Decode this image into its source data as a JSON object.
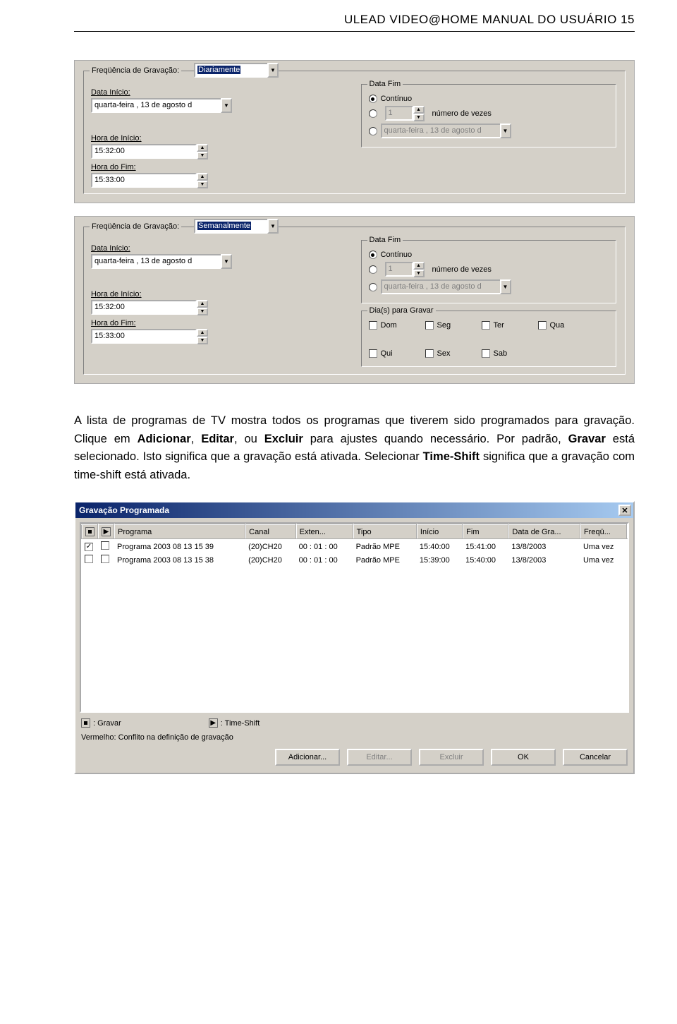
{
  "header": "ULEAD VIDEO@HOME MANUAL DO USUÁRIO  15",
  "panel1": {
    "freq_label": "Freqüência de Gravação:",
    "freq_value": "Diariamente",
    "start_date_label": "Data Início:",
    "start_date_value": "quarta-feira , 13 de   agosto   d",
    "end_group_label": "Data Fim",
    "radio_continuous": "Contínuo",
    "radio_times_value": "1",
    "radio_times_label": "número de vezes",
    "radio_date_value": "quarta-feira , 13 de   agosto   d",
    "start_time_label": "Hora de Início:",
    "start_time_value": "15:32:00",
    "end_time_label": "Hora do Fim:",
    "end_time_value": "15:33:00"
  },
  "panel2": {
    "freq_label": "Freqüência de Gravação:",
    "freq_value": "Semanalmente",
    "start_date_label": "Data Início:",
    "start_date_value": "quarta-feira , 13 de   agosto   d",
    "end_group_label": "Data Fim",
    "radio_continuous": "Contínuo",
    "radio_times_value": "1",
    "radio_times_label": "número de vezes",
    "radio_date_value": "quarta-feira , 13 de   agosto   d",
    "start_time_label": "Hora de Início:",
    "start_time_value": "15:32:00",
    "end_time_label": "Hora do Fim:",
    "end_time_value": "15:33:00",
    "days_label": "Dia(s) para Gravar",
    "days": [
      "Dom",
      "Seg",
      "Ter",
      "Qua",
      "Qui",
      "Sex",
      "Sab"
    ]
  },
  "paragraph": {
    "t1": "A lista de programas de TV mostra todos os programas que tiverem sido programados para gravação. Clique em ",
    "b1": "Adicionar",
    "t2": ", ",
    "b2": "Editar",
    "t3": ", ou ",
    "b3": "Excluir",
    "t4": " para ajustes quando necessário. Por padrão, ",
    "b4": "Gravar",
    "t5": " está selecionado. Isto significa que a gravação está ativada. Selecionar ",
    "b5": "Time-Shift",
    "t6": " significa que a gravação com time-shift está ativada."
  },
  "window": {
    "title": "Gravação Programada",
    "headers": [
      "",
      "",
      "Programa",
      "Canal",
      "Exten...",
      "Tipo",
      "Início",
      "Fim",
      "Data de Gra...",
      "Freqü..."
    ],
    "rows": [
      {
        "chk1": true,
        "chk2": false,
        "programa": "Programa 2003 08 13 15 39",
        "canal": "(20)CH20",
        "exten": "00 : 01 : 00",
        "tipo": "Padrão MPE",
        "inicio": "15:40:00",
        "fim": "15:41:00",
        "data": "13/8/2003",
        "freq": "Uma vez"
      },
      {
        "chk1": false,
        "chk2": false,
        "programa": "Programa 2003 08 13 15 38",
        "canal": "(20)CH20",
        "exten": "00 : 01 : 00",
        "tipo": "Padrão MPE",
        "inicio": "15:39:00",
        "fim": "15:40:00",
        "data": "13/8/2003",
        "freq": "Uma vez"
      }
    ],
    "legend_gravar": ": Gravar",
    "legend_timeshift": ": Time-Shift",
    "legend_red": "Vermelho: Conflito na definição de gravação",
    "buttons": {
      "add": "Adicionar...",
      "edit": "Editar...",
      "del": "Excluir",
      "ok": "OK",
      "cancel": "Cancelar"
    }
  }
}
